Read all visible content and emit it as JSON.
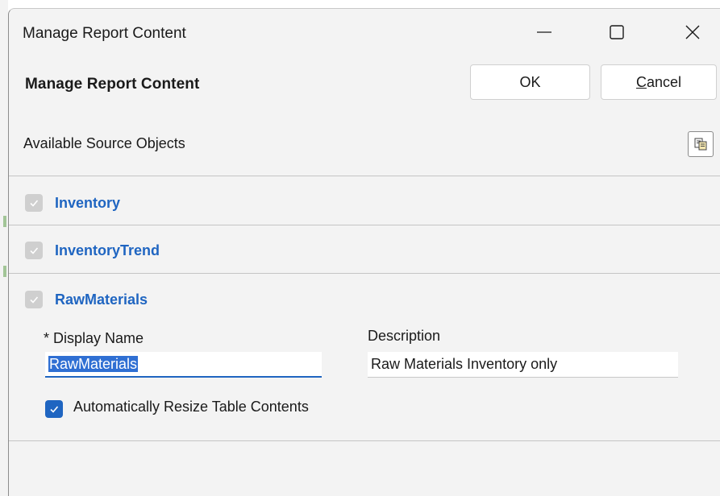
{
  "window": {
    "title": "Manage Report Content",
    "controls": {
      "minimize_icon": "minimize-icon",
      "maximize_icon": "maximize-icon",
      "close_icon": "close-icon"
    }
  },
  "header": {
    "title": "Manage Report Content",
    "ok_label": "OK",
    "cancel_label_mnemonic": "C",
    "cancel_label_rest": "ancel"
  },
  "source_objects": {
    "label": "Available Source Objects",
    "tool_icon": "copy-paste-icon",
    "items": [
      {
        "name": "Inventory",
        "checked": true,
        "disabled": true
      },
      {
        "name": "InventoryTrend",
        "checked": true,
        "disabled": true
      },
      {
        "name": "RawMaterials",
        "checked": true,
        "disabled": true
      }
    ]
  },
  "details": {
    "display_name_label": "* Display Name",
    "display_name_value": "RawMaterials",
    "description_label": "Description",
    "description_value": "Raw Materials Inventory only",
    "auto_resize_label": "Automatically Resize Table Contents",
    "auto_resize_checked": true
  },
  "colors": {
    "accent": "#1f65c1",
    "dialog_background": "#f3f3f3",
    "selection": "#2f6fd3"
  }
}
